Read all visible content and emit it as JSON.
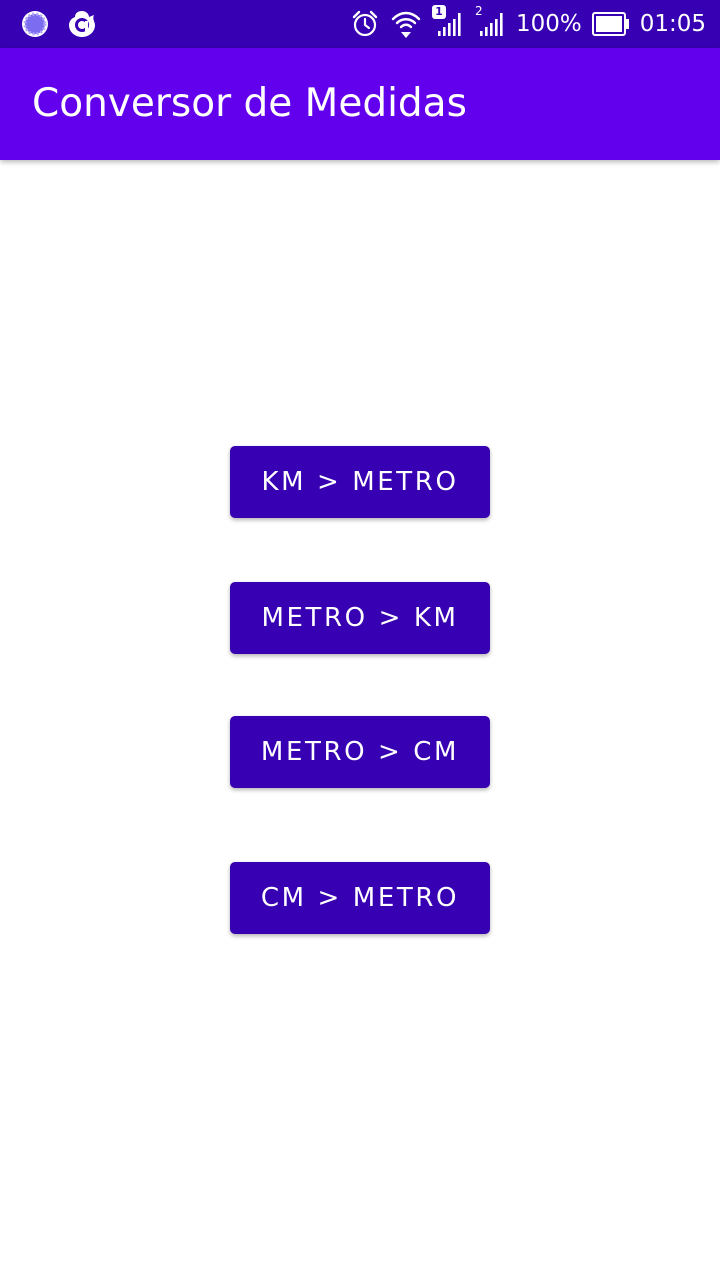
{
  "status_bar": {
    "left_icons": [
      "loading-spinner-icon",
      "avast-icon"
    ],
    "right_icons": [
      "alarm-icon",
      "wifi-icon",
      "signal-sim1-icon",
      "signal-sim2-icon",
      "battery-icon"
    ],
    "sim1_label": "1",
    "sim2_label": "2",
    "battery_percent": "100%",
    "time": "01:05",
    "background_color": "#3700b3"
  },
  "app_bar": {
    "title": "Conversor de Medidas",
    "background_color": "#6200ee"
  },
  "buttons": [
    {
      "label": "KM > METRO"
    },
    {
      "label": "METRO > KM"
    },
    {
      "label": "METRO > CM"
    },
    {
      "label": "CM > METRO"
    }
  ],
  "colors": {
    "button_background": "#3700b3",
    "button_text": "#ffffff",
    "page_background": "#ffffff"
  }
}
